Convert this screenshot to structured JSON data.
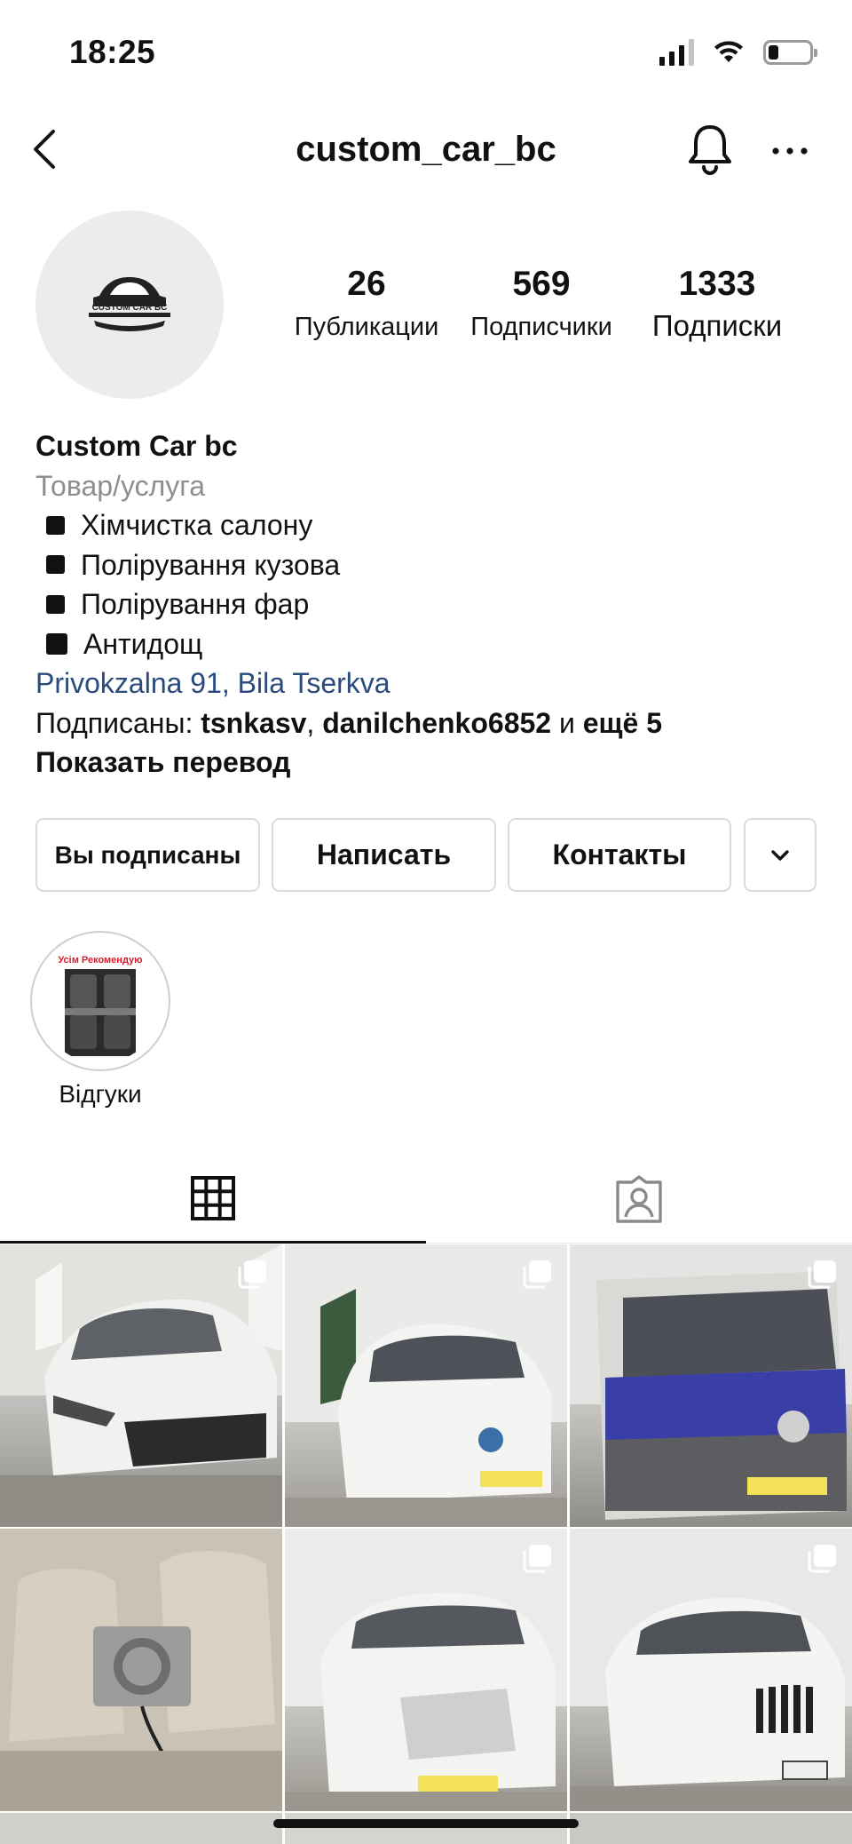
{
  "status_bar": {
    "time": "18:25",
    "battery_level": 0.25
  },
  "header": {
    "username": "custom_car_bc"
  },
  "profile": {
    "avatar_text": "CUSTOM CAR BC",
    "stats": [
      {
        "value": "26",
        "label": "Публикации"
      },
      {
        "value": "569",
        "label": "Подписчики"
      },
      {
        "value": "1333",
        "label": "Подписки"
      }
    ]
  },
  "bio": {
    "name": "Custom Car bc",
    "category": "Товар/услуга",
    "services": [
      "Хімчистка салону",
      "Полірування кузова",
      "Полірування фар",
      "Антидощ"
    ],
    "location": "Privokzalna 91, Bila Tserkva",
    "followed_by_prefix": "Подписаны: ",
    "followed_by_user1": "tsnkasv",
    "followed_by_sep": ", ",
    "followed_by_user2": "danilchenko6852",
    "followed_by_and": " и ",
    "followed_by_more": "ещё 5",
    "show_translation": "Показать перевод"
  },
  "buttons": {
    "following": "Вы подписаны",
    "message": "Написать",
    "contacts": "Контакты"
  },
  "highlights": [
    {
      "label": "Відгуки",
      "cover_text": "Усім Рекомендую"
    }
  ],
  "tabs": {
    "active": "grid"
  },
  "colors": {
    "link": "#2b4a7e",
    "category": "#8e8e8e",
    "highlight_red": "#d4202c",
    "van_blue": "#3a3fa8"
  }
}
